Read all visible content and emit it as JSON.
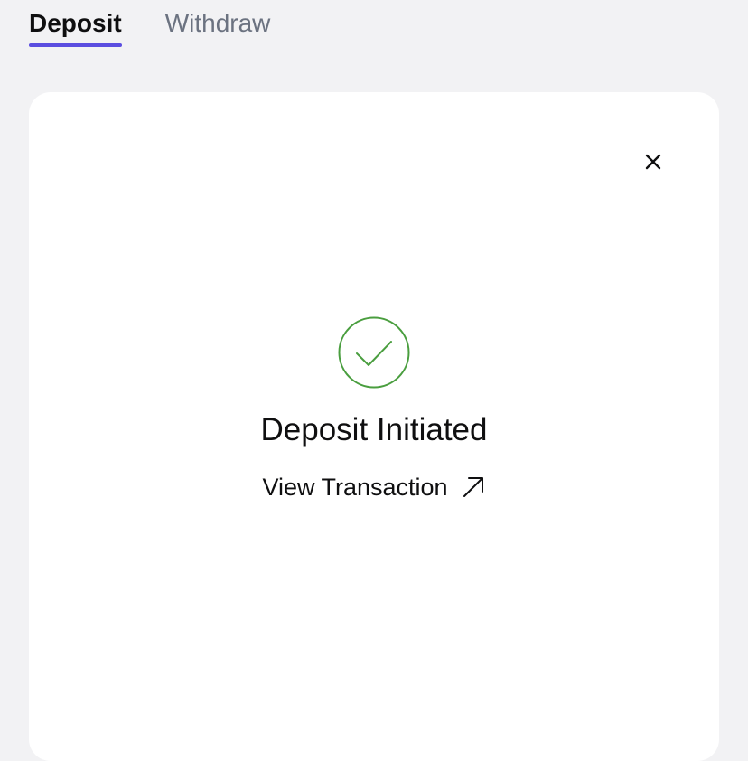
{
  "tabs": [
    {
      "label": "Deposit",
      "active": true
    },
    {
      "label": "Withdraw",
      "active": false
    }
  ],
  "colors": {
    "accent": "#5b4ee0",
    "success": "#4a9e3f",
    "text": "#0f0f10",
    "muted": "#6b7280",
    "background": "#f2f2f4",
    "card": "#ffffff"
  },
  "panel": {
    "close_icon": "close-icon",
    "status_icon": "check-circle-icon",
    "title": "Deposit Initiated",
    "link_label": "View Transaction",
    "link_icon": "arrow-up-right-icon"
  }
}
